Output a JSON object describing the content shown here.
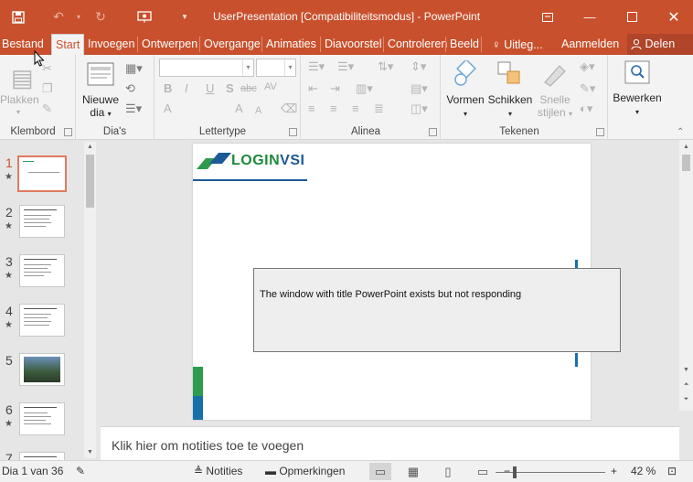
{
  "titlebar": {
    "title": "UserPresentation [Compatibiliteitsmodus] - PowerPoint",
    "icons": [
      "save-icon",
      "undo-icon",
      "redo-icon",
      "start-presentation-icon",
      "customize-qat-icon",
      "ribbon-display-options-icon",
      "minimize-icon",
      "maximize-icon",
      "close-icon"
    ]
  },
  "tabs": {
    "file": "Bestand",
    "items": [
      "Start",
      "Invoegen",
      "Ontwerpen",
      "Overgange",
      "Animaties",
      "Diavoorstel",
      "Controleren",
      "Beeld"
    ],
    "tell_me": "Uitleg...",
    "sign_in": "Aanmelden",
    "share": "Delen"
  },
  "ribbon": {
    "clipboard": {
      "label": "Klembord",
      "paste": "Plakken"
    },
    "slides": {
      "label": "Dia's",
      "new_slide_line1": "Nieuwe",
      "new_slide_line2": "dia"
    },
    "font": {
      "label": "Lettertype",
      "bold": "B",
      "italic": "I",
      "underline": "U",
      "shadow": "S",
      "strike": "abc",
      "spacing": "AV",
      "font_color": "A",
      "grow": "A",
      "shrink": "A"
    },
    "paragraph": {
      "label": "Alinea"
    },
    "drawing": {
      "label": "Tekenen",
      "shapes": "Vormen",
      "arrange": "Schikken",
      "quick_styles_line1": "Snelle",
      "quick_styles_line2": "stijlen"
    },
    "editing": {
      "label": "Bewerken"
    }
  },
  "slides_pane": {
    "numbers": [
      "1",
      "2",
      "3",
      "4",
      "5",
      "6",
      "7"
    ],
    "active_index": 0
  },
  "slide": {
    "logo_part1": "LOGIN",
    "logo_part2": "VSI"
  },
  "dialog": {
    "message": "The window with title PowerPoint exists but not responding"
  },
  "notes": {
    "placeholder": "Klik hier om notities toe te voegen"
  },
  "status": {
    "slide_info": "Dia 1 van 36",
    "notes": "Notities",
    "comments": "Opmerkingen",
    "zoom": "42 %",
    "zoom_level_percent": 42
  },
  "colors": {
    "accent": "#c9502d",
    "logo_green": "#1e8a3c",
    "logo_blue": "#1b5a96"
  }
}
